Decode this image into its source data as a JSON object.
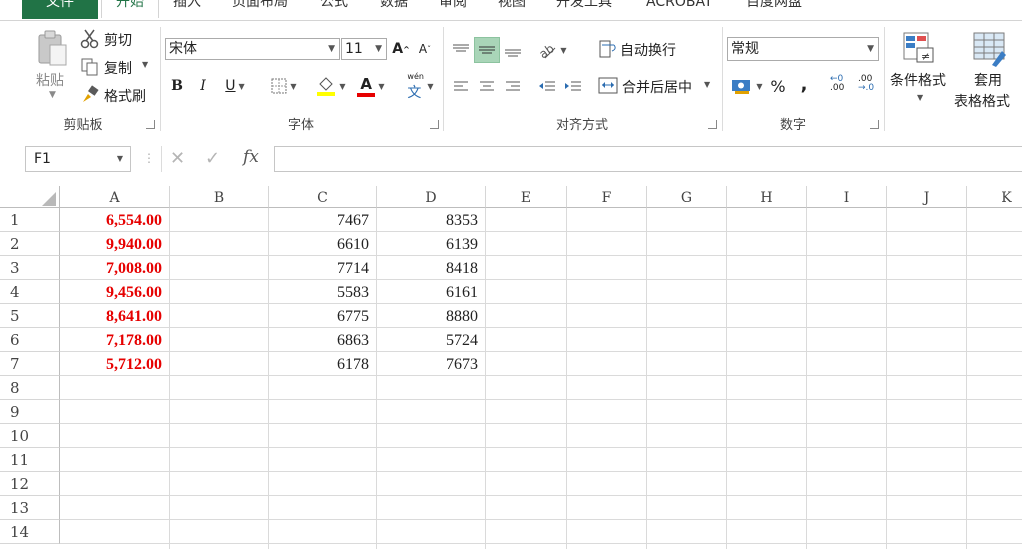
{
  "tabs": [
    "文件",
    "开始",
    "插入",
    "页面布局",
    "公式",
    "数据",
    "审阅",
    "视图",
    "开发工具",
    "ACROBAT",
    "百度网盘"
  ],
  "clipboard": {
    "paste": "粘贴",
    "cut": "剪切",
    "copy": "复制",
    "format_painter": "格式刷",
    "label": "剪贴板"
  },
  "font": {
    "name": "宋体",
    "size": "11",
    "label": "字体",
    "bold": "B",
    "italic": "I",
    "underline": "U",
    "grow": "A",
    "shrink": "A",
    "font_color": "A",
    "phonetic": "文",
    "phonetic_top": "wén"
  },
  "alignment": {
    "wrap_text": "自动换行",
    "merge_center": "合并后居中",
    "label": "对齐方式"
  },
  "number": {
    "format": "常规",
    "percent": "%",
    "comma": ",",
    "label": "数字",
    "inc_dec": ".00",
    "inc_dec2": ".0"
  },
  "styles": {
    "conditional": "条件格式",
    "table_format_1": "套用",
    "table_format_2": "表格格式"
  },
  "formula_bar": {
    "name_box": "F1",
    "fx": "fx",
    "value": ""
  },
  "columns": [
    "A",
    "B",
    "C",
    "D",
    "E",
    "F",
    "G",
    "H",
    "I",
    "J",
    "K"
  ],
  "rows": [
    "1",
    "2",
    "3",
    "4",
    "5",
    "6",
    "7",
    "8",
    "9",
    "10",
    "11",
    "12",
    "13",
    "14"
  ],
  "cells": {
    "A": [
      "6,554.00",
      "9,940.00",
      "7,008.00",
      "9,456.00",
      "8,641.00",
      "7,178.00",
      "5,712.00"
    ],
    "C": [
      "7467",
      "6610",
      "7714",
      "5583",
      "6775",
      "6863",
      "6178"
    ],
    "D": [
      "8353",
      "6139",
      "8418",
      "6161",
      "8880",
      "5724",
      "7673"
    ]
  },
  "colors": {
    "accent": "#217346",
    "red_text": "#e60000",
    "selected_btn": "#a9d5b8"
  }
}
